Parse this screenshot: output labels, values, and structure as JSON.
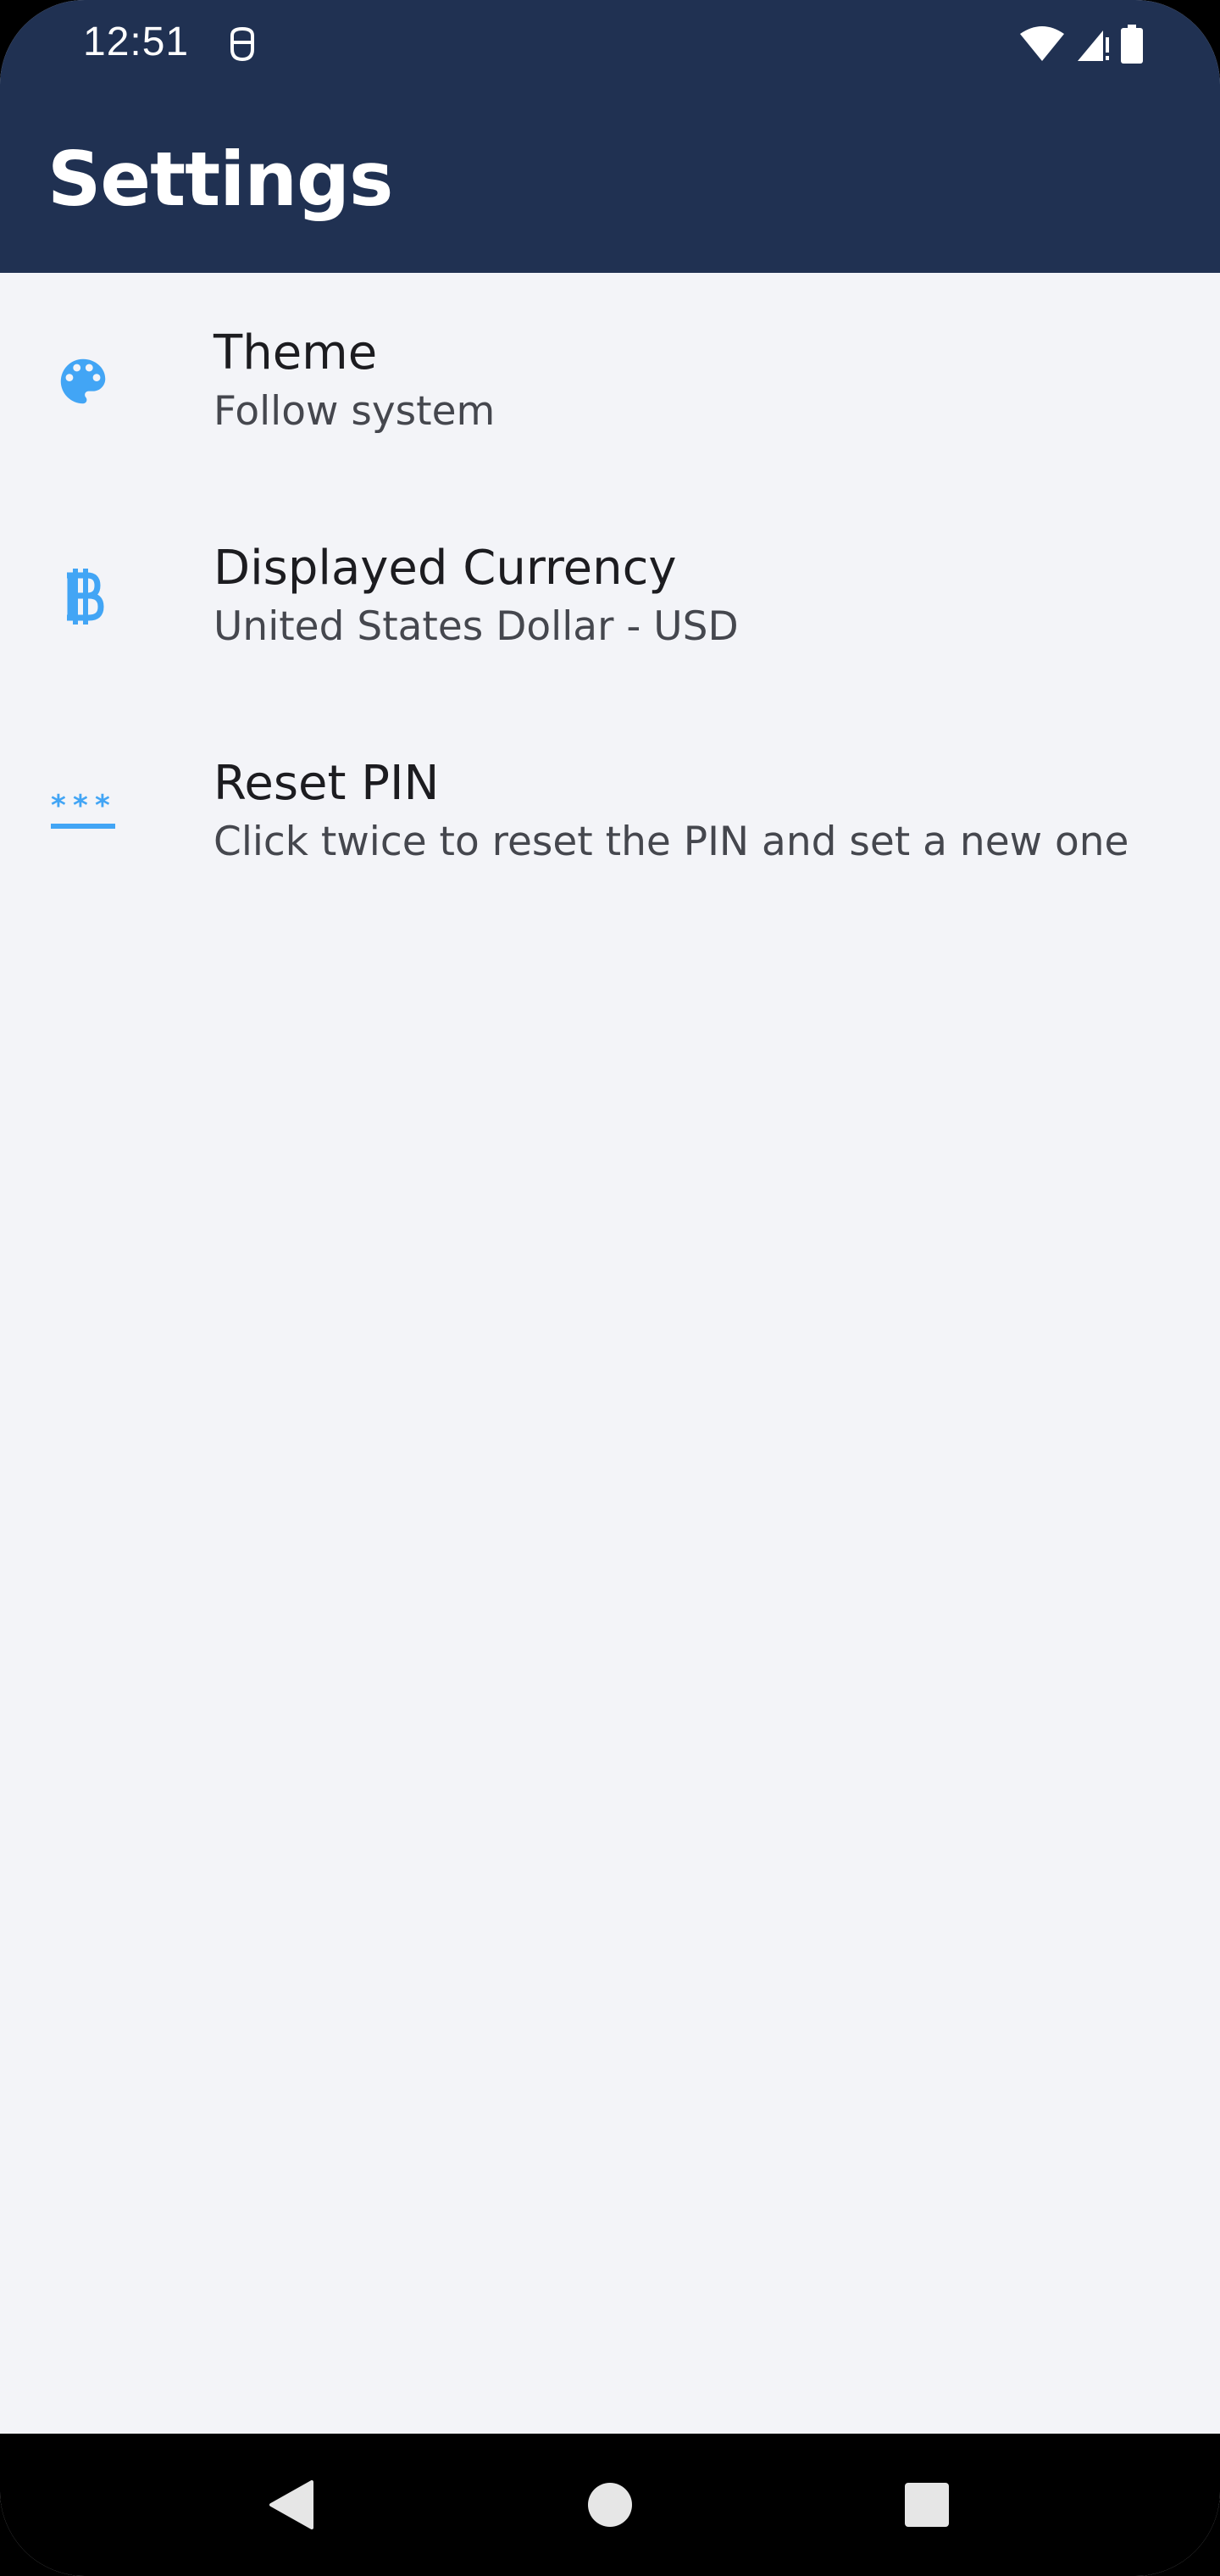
{
  "status_bar": {
    "time": "12:51",
    "app_icon": "notification-app-icon",
    "wifi_icon": "wifi-icon",
    "signal_icon": "cell-signal-icon",
    "battery_icon": "battery-icon"
  },
  "header": {
    "title": "Settings",
    "background_color": "#203152"
  },
  "settings": {
    "items": [
      {
        "icon": "palette-icon",
        "title": "Theme",
        "subtitle": "Follow system"
      },
      {
        "icon": "bitcoin-icon",
        "title": "Displayed Currency",
        "subtitle": "United States Dollar - USD"
      },
      {
        "icon": "password-icon",
        "title": "Reset PIN",
        "subtitle": "Click twice to reset the PIN and set a new one"
      }
    ],
    "icon_color": "#42a5f5"
  },
  "nav_bar": {
    "back_icon": "back-triangle-icon",
    "home_icon": "home-circle-icon",
    "recents_icon": "recents-square-icon"
  }
}
